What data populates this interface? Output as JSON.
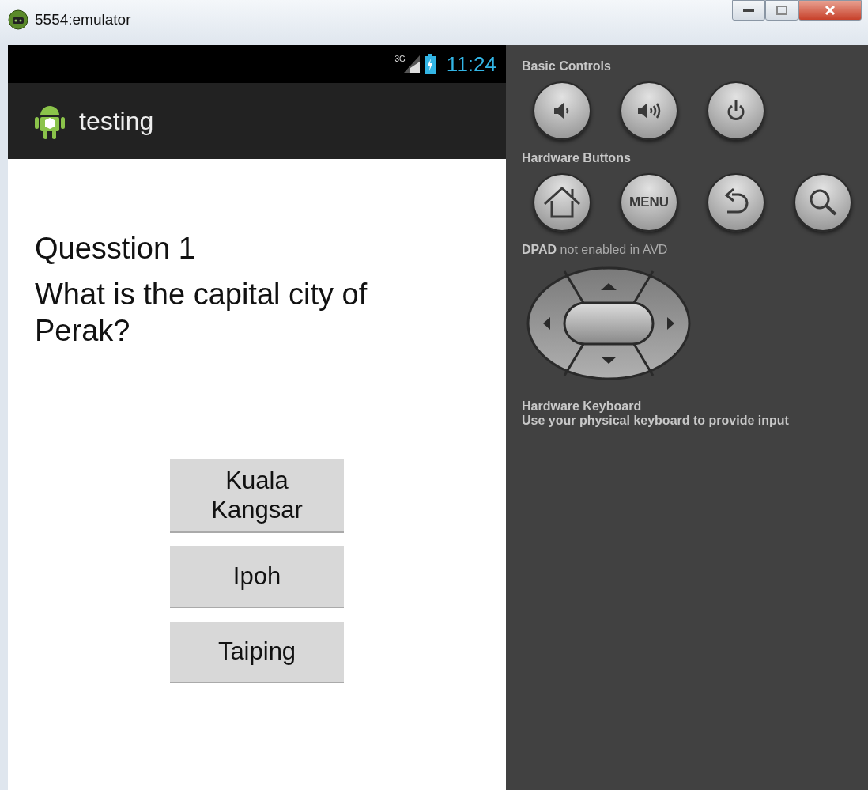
{
  "window": {
    "title": "5554:emulator"
  },
  "status_bar": {
    "network": "3G",
    "time": "11:24"
  },
  "action_bar": {
    "title": "testing"
  },
  "question": {
    "number": "Quesstion 1",
    "text": "What is the capital city of Perak?"
  },
  "answers": [
    {
      "label": "Kuala Kangsar"
    },
    {
      "label": "Ipoh"
    },
    {
      "label": "Taiping"
    }
  ],
  "basic_controls": {
    "heading": "Basic Controls",
    "buttons": [
      {
        "kind": "volume-down"
      },
      {
        "kind": "volume-up"
      },
      {
        "kind": "power"
      }
    ]
  },
  "hardware_buttons": {
    "heading": "Hardware Buttons",
    "buttons": [
      {
        "kind": "home"
      },
      {
        "kind": "menu",
        "label": "MENU"
      },
      {
        "kind": "back"
      },
      {
        "kind": "search"
      }
    ]
  },
  "dpad": {
    "heading": "**DPAD** not enabled in AVD"
  },
  "keyboard": {
    "heading": "Hardware Keyboard",
    "text": "Use your physical keyboard to provide input"
  }
}
